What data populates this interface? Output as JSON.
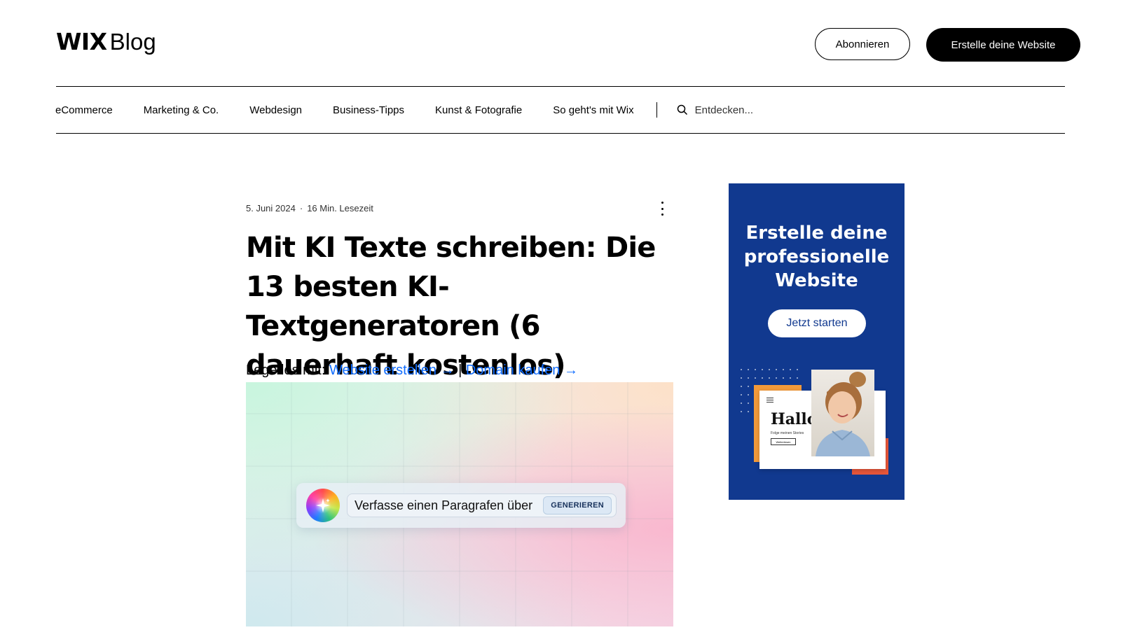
{
  "header": {
    "logo_wix": "WIX",
    "logo_blog": "Blog",
    "subscribe_label": "Abonnieren",
    "create_site_label": "Erstelle deine Website"
  },
  "nav": {
    "items": [
      "eCommerce",
      "Marketing & Co.",
      "Webdesign",
      "Business-Tipps",
      "Kunst & Fotografie",
      "So geht's mit Wix"
    ],
    "search_placeholder": "Entdecken..."
  },
  "article": {
    "date": "5. Juni 2024",
    "separator": "·",
    "read_time": "16 Min. Lesezeit",
    "title": "Mit KI Texte schreiben: Die 13 besten KI-Textgeneratoren (6 dauerhaft kostenlos)",
    "getstarted_prefix": "Lege los mit: ",
    "link_website": "Website erstellen →",
    "pipe": " | ",
    "link_domain": "Domain kaufen →",
    "hero": {
      "prompt_text": "Verfasse einen Paragrafen über",
      "generate_label": "GENERIEREN"
    }
  },
  "ad": {
    "headline": "Erstelle deine professionelle Website",
    "cta_label": "Jetzt starten",
    "mock_title": "Hallo!",
    "mock_subtitle": "Folge meinen Stories",
    "mock_button": "Weiterlesen"
  },
  "colors": {
    "link": "#116dff",
    "ad_bg": "#11398f",
    "ad_orange": "#f39a3a",
    "ad_red": "#e8573a"
  }
}
